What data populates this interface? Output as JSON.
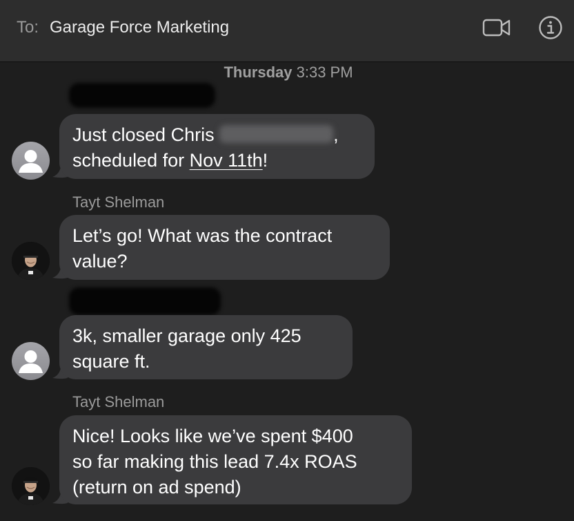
{
  "header": {
    "to_label": "To:",
    "recipient": "Garage Force Marketing",
    "video_icon": "video-camera-icon",
    "info_icon": "info-icon"
  },
  "timestamp": {
    "day": "Thursday",
    "time": "3:33 PM"
  },
  "messages": [
    {
      "sender": "",
      "avatar": "default-avatar-icon",
      "line1_prefix": "Just closed Chris",
      "line1_suffix": ",",
      "line2_prefix": "scheduled for ",
      "line2_link": "Nov 11th",
      "line2_suffix": "!"
    },
    {
      "sender": "Tayt Shelman",
      "avatar": "profile-photo",
      "line1": "Let’s go! What was the contract",
      "line2": "value?"
    },
    {
      "sender": "",
      "avatar": "default-avatar-icon",
      "line1": "3k, smaller garage only 425",
      "line2": "square ft."
    },
    {
      "sender": "Tayt Shelman",
      "avatar": "profile-photo",
      "line1": "Nice! Looks like we’ve spent $400",
      "line2": "so far making this lead 7.4x ROAS",
      "line3": "(return on ad spend)"
    }
  ],
  "colors": {
    "background": "#1e1e1e",
    "header": "#2d2d2d",
    "bubble": "#3b3b3d",
    "secondary_text": "#9b9b9b"
  }
}
